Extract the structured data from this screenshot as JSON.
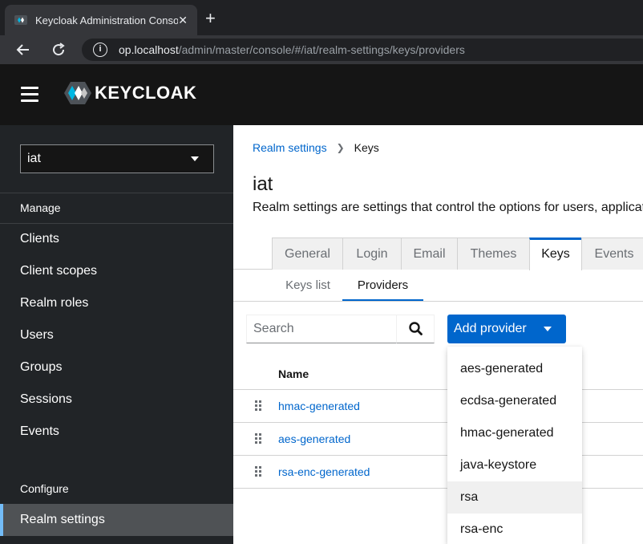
{
  "browser": {
    "tab_title": "Keycloak Administration Console",
    "tab_close": "✕",
    "new_tab": "+",
    "url_host": "op.localhost",
    "url_path": "/admin/master/console/#/iat/realm-settings/keys/providers"
  },
  "header": {
    "logo_text": "KEYCLOAK"
  },
  "sidebar": {
    "realm": "iat",
    "manage_label": "Manage",
    "manage_items": [
      "Clients",
      "Client scopes",
      "Realm roles",
      "Users",
      "Groups",
      "Sessions",
      "Events"
    ],
    "configure_label": "Configure",
    "configure_items": [
      "Realm settings"
    ]
  },
  "main": {
    "breadcrumb": {
      "parent": "Realm settings",
      "current": "Keys"
    },
    "title": "iat",
    "description": "Realm settings are settings that control the options for users, applications, roles, and groups in the current realm.",
    "tabs": [
      "General",
      "Login",
      "Email",
      "Themes",
      "Keys",
      "Events"
    ],
    "active_tab": "Keys",
    "subtabs": [
      "Keys list",
      "Providers"
    ],
    "active_subtab": "Providers",
    "search_placeholder": "Search",
    "add_provider_label": "Add provider",
    "column_name": "Name",
    "providers": [
      "hmac-generated",
      "aes-generated",
      "rsa-enc-generated"
    ]
  },
  "dropdown": {
    "items": [
      "aes-generated",
      "ecdsa-generated",
      "hmac-generated",
      "java-keystore",
      "rsa",
      "rsa-enc"
    ],
    "hovered": "rsa"
  },
  "colors": {
    "accent": "#0066cc",
    "header_bg": "#151515",
    "sidebar_bg": "#212427",
    "active_indicator": "#73bcf7"
  }
}
